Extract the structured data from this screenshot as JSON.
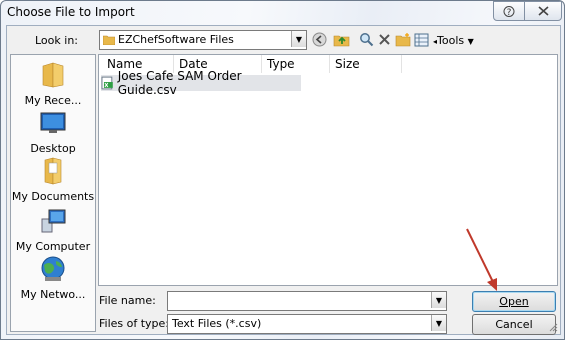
{
  "window": {
    "title": "Choose File to Import"
  },
  "toolbar": {
    "look_in_label": "Look in:",
    "look_in_value": "EZChefSoftware Files",
    "tools_label": "Tools"
  },
  "places": [
    {
      "label": "My Rece..."
    },
    {
      "label": "Desktop"
    },
    {
      "label": "My Documents"
    },
    {
      "label": "My Computer"
    },
    {
      "label": "My Netwo..."
    }
  ],
  "list": {
    "columns": [
      "Name",
      "Date modified",
      "Type",
      "Size"
    ],
    "files": [
      {
        "name": "Joes Cafe SAM Order Guide.csv"
      }
    ]
  },
  "form": {
    "file_name_label": "File name:",
    "file_name_value": "",
    "file_type_label": "Files of type:",
    "file_type_value": "Text Files (*.csv)"
  },
  "buttons": {
    "open": "Open",
    "cancel": "Cancel"
  },
  "colors": {
    "annotation_arrow": "#c0392b"
  }
}
